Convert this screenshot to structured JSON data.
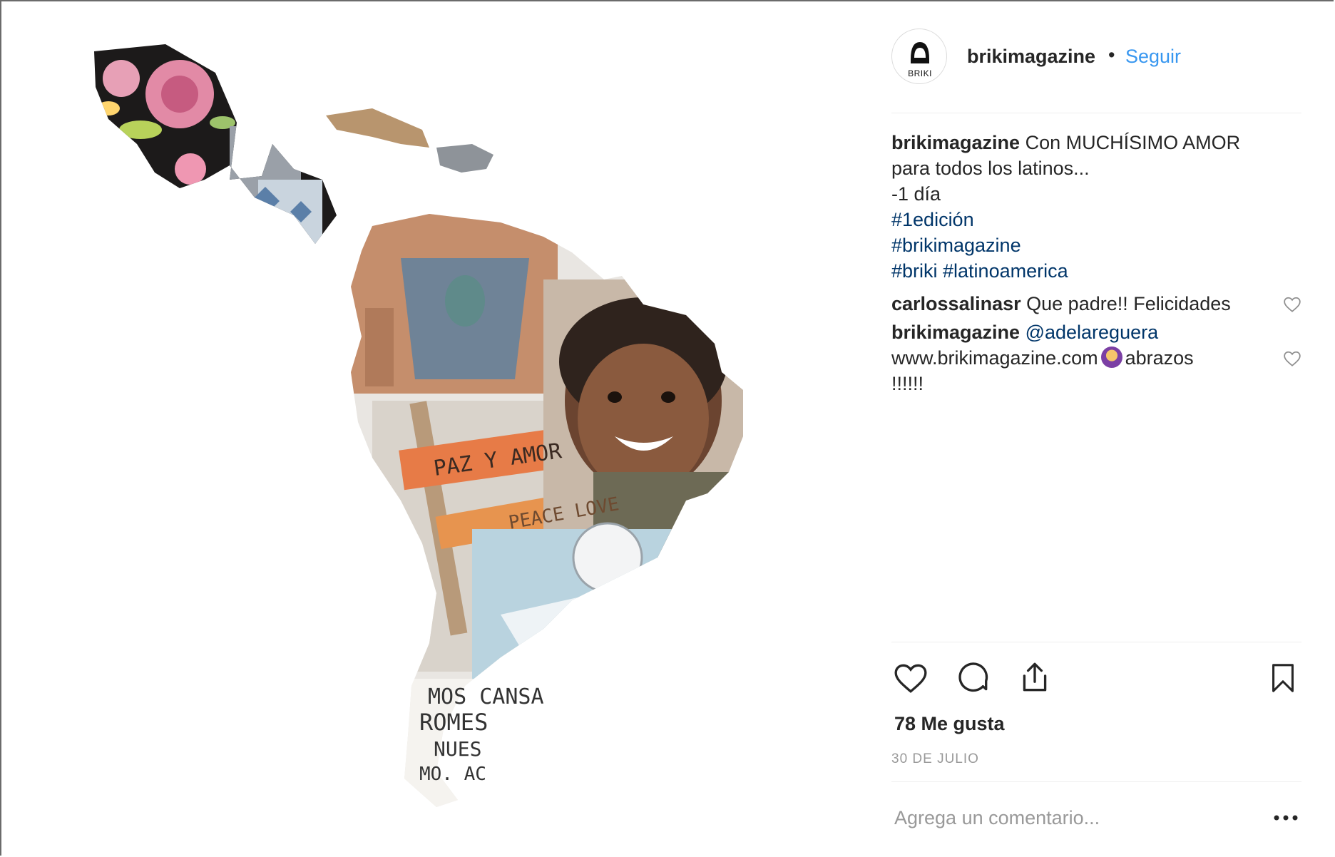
{
  "post": {
    "avatar_label": "BRIKI",
    "username": "brikimagazine",
    "separator": "•",
    "follow_label": "Seguir",
    "caption": {
      "username": "brikimagazine",
      "text_line1": "Con MUCHÍSIMO AMOR",
      "text_line2": "para todos los latinos...",
      "text_line3": "-1 día",
      "hashtag1": "#1edición",
      "hashtag2": "#brikimagazine",
      "hashtag3": "#briki #latinoamerica"
    },
    "comments": [
      {
        "username": "carlossalinasr",
        "text": "Que padre!! Felicidades"
      },
      {
        "username": "brikimagazine",
        "mention": "@adelareguera",
        "text_a": "www.brikimagazine.com",
        "text_b": "abrazos",
        "text_c": "!!!!!!"
      }
    ],
    "likes_label": "78 Me gusta",
    "date_label": "30 DE JULIO",
    "comment_placeholder": "Agrega un comentario...",
    "more_label": "•••"
  },
  "collage_text": {
    "sign1": "PAZ Y AMOR",
    "sign2": "PEACE LOVE",
    "note1": "MOS CANSA",
    "note2": "ROMES",
    "note3": "NUES",
    "note4": "MO. AC"
  },
  "colors": {
    "link": "#3897f0",
    "hashtag": "#003569",
    "muted": "#999999",
    "text": "#262626"
  },
  "icons": [
    "heart-icon",
    "comment-icon",
    "share-icon",
    "bookmark-icon",
    "more-icon"
  ]
}
